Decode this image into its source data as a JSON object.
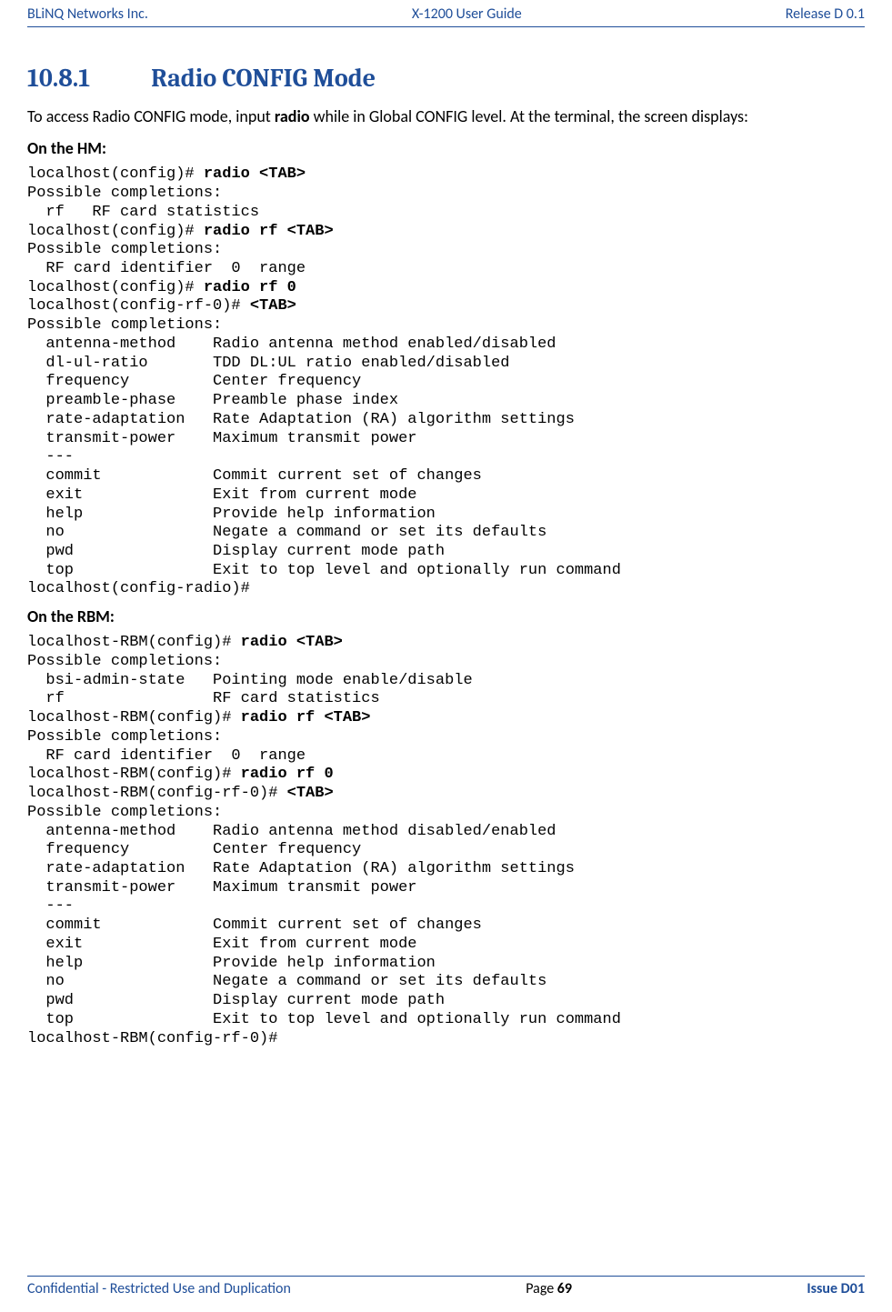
{
  "header": {
    "left": "BLiNQ Networks Inc.",
    "center": "X-1200 User Guide",
    "right": "Release D 0.1"
  },
  "section": {
    "number": "10.8.1",
    "title": "Radio CONFIG Mode"
  },
  "intro": {
    "pre": "To access Radio CONFIG mode, input ",
    "bold": "radio",
    "post": " while in Global CONFIG level. At the terminal, the screen displays:"
  },
  "hm": {
    "label": "On the HM:",
    "t": {
      "l01a": "localhost(config)# ",
      "l01b": "radio <TAB>",
      "l02": "Possible completions:",
      "l03": "  rf   RF card statistics",
      "l04a": "localhost(config)# ",
      "l04b": "radio rf <TAB>",
      "l05": "Possible completions:",
      "l06": "  RF card identifier  0  range",
      "l07a": "localhost(config)# ",
      "l07b": "radio rf 0",
      "l08a": "localhost(config-rf-0)# ",
      "l08b": "<TAB>",
      "l09": "Possible completions:",
      "l10": "  antenna-method    Radio antenna method enabled/disabled",
      "l11": "  dl-ul-ratio       TDD DL:UL ratio enabled/disabled",
      "l12": "  frequency         Center frequency",
      "l13": "  preamble-phase    Preamble phase index",
      "l14": "  rate-adaptation   Rate Adaptation (RA) algorithm settings",
      "l15": "  transmit-power    Maximum transmit power",
      "l16": "  ---",
      "l17": "  commit            Commit current set of changes",
      "l18": "  exit              Exit from current mode",
      "l19": "  help              Provide help information",
      "l20": "  no                Negate a command or set its defaults",
      "l21": "  pwd               Display current mode path",
      "l22": "  top               Exit to top level and optionally run command",
      "l23": "localhost(config-radio)#"
    }
  },
  "rbm": {
    "label": "On the RBM:",
    "t": {
      "l01a": "localhost-RBM(config)# ",
      "l01b": "radio <TAB>",
      "l02": "Possible completions:",
      "l03": "  bsi-admin-state   Pointing mode enable/disable",
      "l04": "  rf                RF card statistics",
      "l05a": "localhost-RBM(config)# ",
      "l05b": "radio rf <TAB>",
      "l06": "Possible completions:",
      "l07": "  RF card identifier  0  range",
      "l08a": "localhost-RBM(config)# ",
      "l08b": "radio rf 0",
      "l09a": "localhost-RBM(config-rf-0)# ",
      "l09b": "<TAB>",
      "l10": "Possible completions:",
      "l11": "  antenna-method    Radio antenna method disabled/enabled",
      "l12": "  frequency         Center frequency",
      "l13": "  rate-adaptation   Rate Adaptation (RA) algorithm settings",
      "l14": "  transmit-power    Maximum transmit power",
      "l15": "  ---",
      "l16": "  commit            Commit current set of changes",
      "l17": "  exit              Exit from current mode",
      "l18": "  help              Provide help information",
      "l19": "  no                Negate a command or set its defaults",
      "l20": "  pwd               Display current mode path",
      "l21": "  top               Exit to top level and optionally run command",
      "l22": "localhost-RBM(config-rf-0)#"
    }
  },
  "footer": {
    "left": "Confidential - Restricted Use and Duplication",
    "page_label": "Page ",
    "page_num": "69",
    "right": "Issue D01"
  }
}
